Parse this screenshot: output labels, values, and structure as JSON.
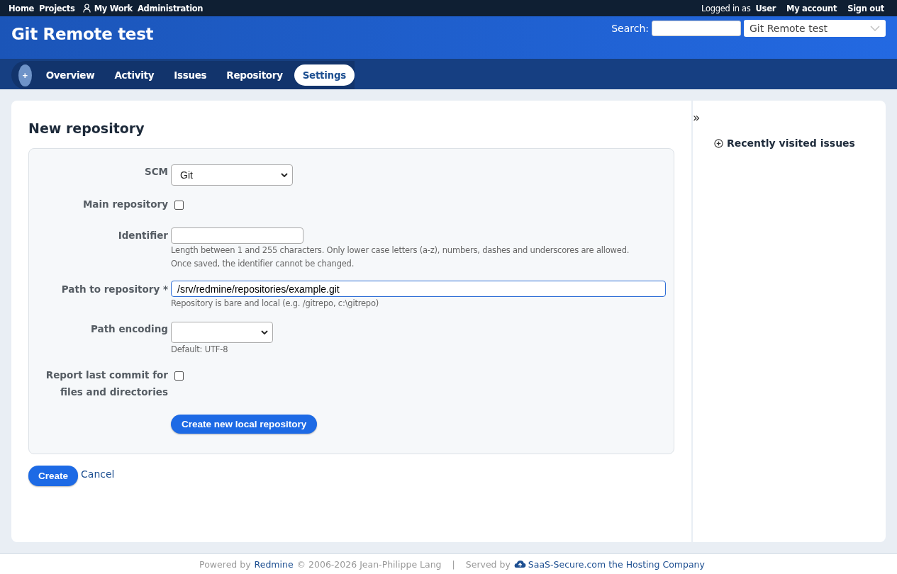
{
  "top_menu": {
    "left": [
      {
        "label": "Home",
        "kind": "plain"
      },
      {
        "label": "Projects",
        "kind": "plain"
      },
      {
        "label": "My Work",
        "kind": "user"
      },
      {
        "label": "Administration",
        "kind": "plain"
      }
    ],
    "logged_in_prefix": "Logged in as",
    "user": "User",
    "right": [
      "My account",
      "Sign out"
    ]
  },
  "header": {
    "title": "Git Remote test",
    "search_label": "Search:",
    "project_jump": "Git Remote test"
  },
  "new_object": "+",
  "tabs": [
    {
      "label": "Overview",
      "selected": false
    },
    {
      "label": "Activity",
      "selected": false
    },
    {
      "label": "Issues",
      "selected": false
    },
    {
      "label": "Repository",
      "selected": false
    },
    {
      "label": "Settings",
      "selected": true
    }
  ],
  "page_title": "New repository",
  "fields": [
    {
      "kind": "select",
      "label": "SCM",
      "value": "Git"
    },
    {
      "kind": "checkbox",
      "label": "Main repository",
      "checked": false
    },
    {
      "kind": "text",
      "label": "Identifier",
      "hints": [
        "Length between 1 and 255 characters. Only lower case letters (a-z), numbers, dashes and underscores are allowed.",
        "Once saved, the identifier cannot be changed."
      ]
    },
    {
      "kind": "path",
      "label": "Path to repository *",
      "value": "/srv/redmine/repositories/example.git",
      "hints": [
        "Repository is bare and local (e.g. /gitrepo, c:\\gitrepo)"
      ]
    },
    {
      "kind": "encoding",
      "label": "Path encoding",
      "hints": [
        "Default: UTF-8"
      ]
    },
    {
      "kind": "checkbox",
      "label": "Report last commit for files and directories",
      "checked": false
    },
    {
      "kind": "button",
      "label": "Create new local repository"
    }
  ],
  "actions": {
    "submit": "Create",
    "cancel": "Cancel"
  },
  "sidebar": {
    "toggle": "»",
    "section": "Recently visited issues",
    "expanded": false
  },
  "footer": [
    {
      "kind": "text",
      "text": "Powered by"
    },
    {
      "kind": "link",
      "text": "Redmine"
    },
    {
      "kind": "text",
      "text": "© 2006-2026 Jean-Philippe Lang"
    },
    {
      "kind": "sep",
      "text": "|"
    },
    {
      "kind": "text",
      "text": "Served by"
    },
    {
      "kind": "cloud-link",
      "text": "SaaS-Secure.com the Hosting Company"
    }
  ]
}
